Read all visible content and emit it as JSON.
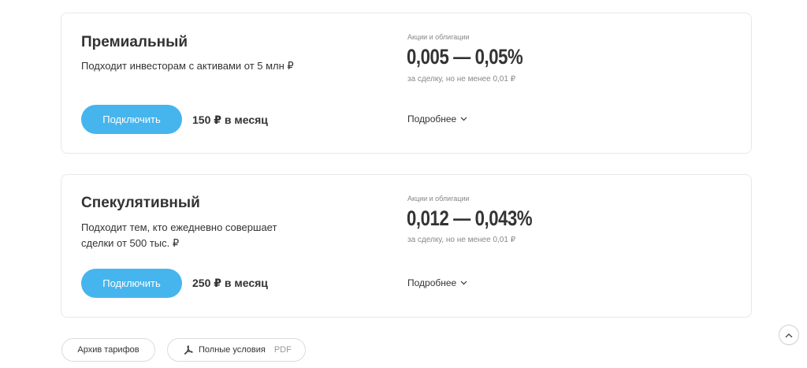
{
  "plans": [
    {
      "title": "Премиальный",
      "description": "Подходит инвесторам с активами от 5 млн ₽",
      "connect_label": "Подключить",
      "price": "150 ₽ в месяц",
      "fee_label": "Акции и облигации",
      "fee_value": "0,005 — 0,05%",
      "fee_note": "за сделку, но не менее 0,01 ₽",
      "details_label": "Подробнее"
    },
    {
      "title": "Спекулятивный",
      "description_line1": "Подходит тем, кто ежедневно совершает",
      "description_line2": "сделки от 500 тыс. ₽",
      "connect_label": "Подключить",
      "price": "250 ₽ в месяц",
      "fee_label": "Акции и облигации",
      "fee_value": "0,012 — 0,043%",
      "fee_note": "за сделку, но не менее 0,01 ₽",
      "details_label": "Подробнее"
    }
  ],
  "footer": {
    "archive_label": "Архив тарифов",
    "terms_label": "Полные условия",
    "terms_format": "PDF"
  },
  "icons": {
    "details": "chevron-down-icon",
    "terms": "pdf-icon",
    "scroll": "arrow-up-icon"
  },
  "colors": {
    "accent": "#46b5ed",
    "text": "#333333",
    "muted": "#888888"
  }
}
